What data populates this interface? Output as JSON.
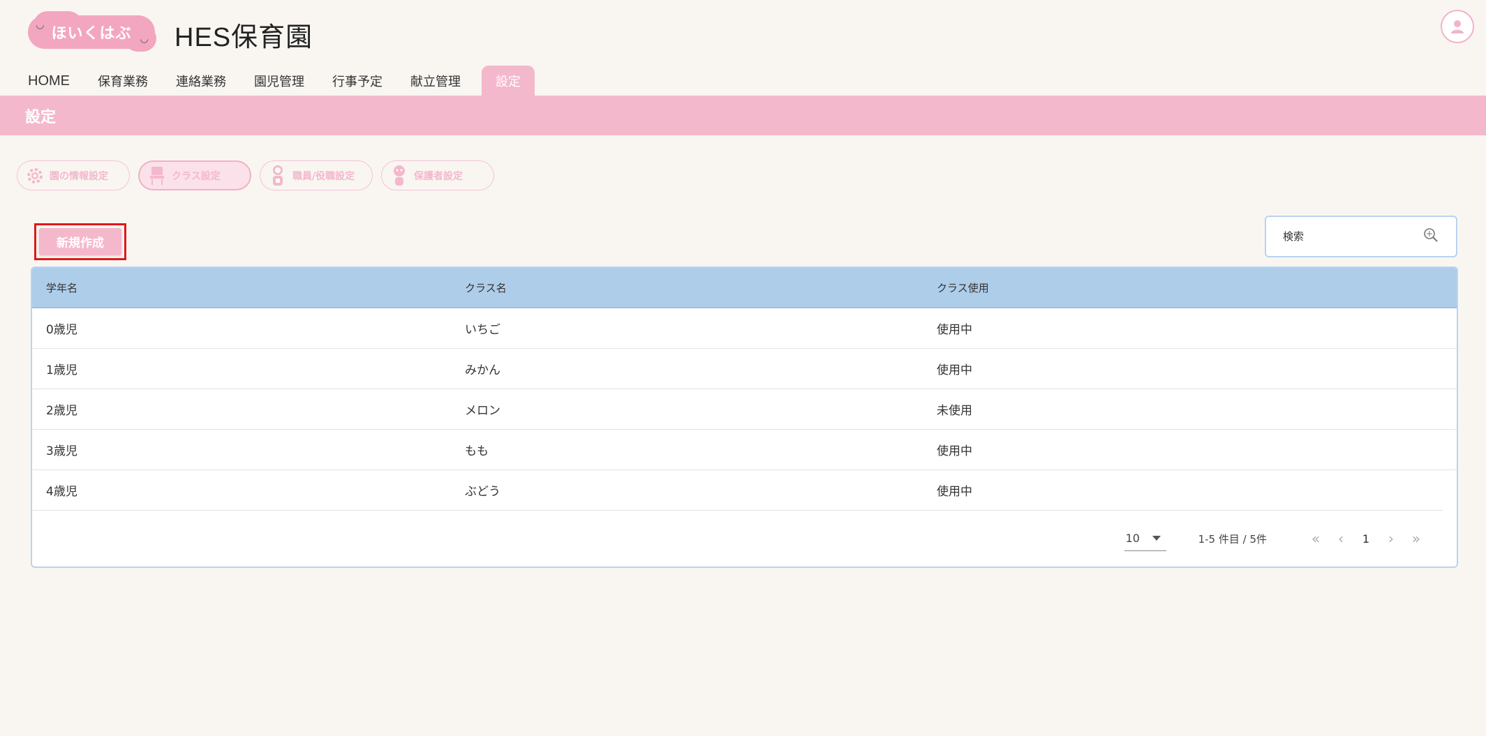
{
  "header": {
    "logo_text": "ほいくはぶ",
    "title": "HES保育園"
  },
  "nav": {
    "items": [
      {
        "label": "HOME"
      },
      {
        "label": "保育業務"
      },
      {
        "label": "連絡業務"
      },
      {
        "label": "園児管理"
      },
      {
        "label": "行事予定"
      },
      {
        "label": "献立管理"
      },
      {
        "label": "設定"
      }
    ],
    "active": "設定"
  },
  "page": {
    "banner_title": "設定"
  },
  "subtabs": [
    {
      "label": "園の情報設定",
      "icon": "gear-icon"
    },
    {
      "label": "クラス設定",
      "icon": "chair-icon"
    },
    {
      "label": "職員/役職設定",
      "icon": "staff-icon"
    },
    {
      "label": "保護者設定",
      "icon": "guardian-icon"
    }
  ],
  "toolbar": {
    "create_label": "新規作成",
    "search_placeholder": "検索"
  },
  "table": {
    "headers": [
      "学年名",
      "クラス名",
      "クラス使用"
    ],
    "rows": [
      [
        "0歳児",
        "いちご",
        "使用中"
      ],
      [
        "1歳児",
        "みかん",
        "使用中"
      ],
      [
        "2歳児",
        "メロン",
        "未使用"
      ],
      [
        "3歳児",
        "もも",
        "使用中"
      ],
      [
        "4歳児",
        "ぶどう",
        "使用中"
      ]
    ]
  },
  "pagination": {
    "rows_per_page": "10",
    "range": "1-5 件目 / 5件",
    "current_page": "1"
  },
  "colors": {
    "accent_pink": "#f4b8cc",
    "table_header_blue": "#aecde9",
    "highlight_red": "#e01818"
  }
}
